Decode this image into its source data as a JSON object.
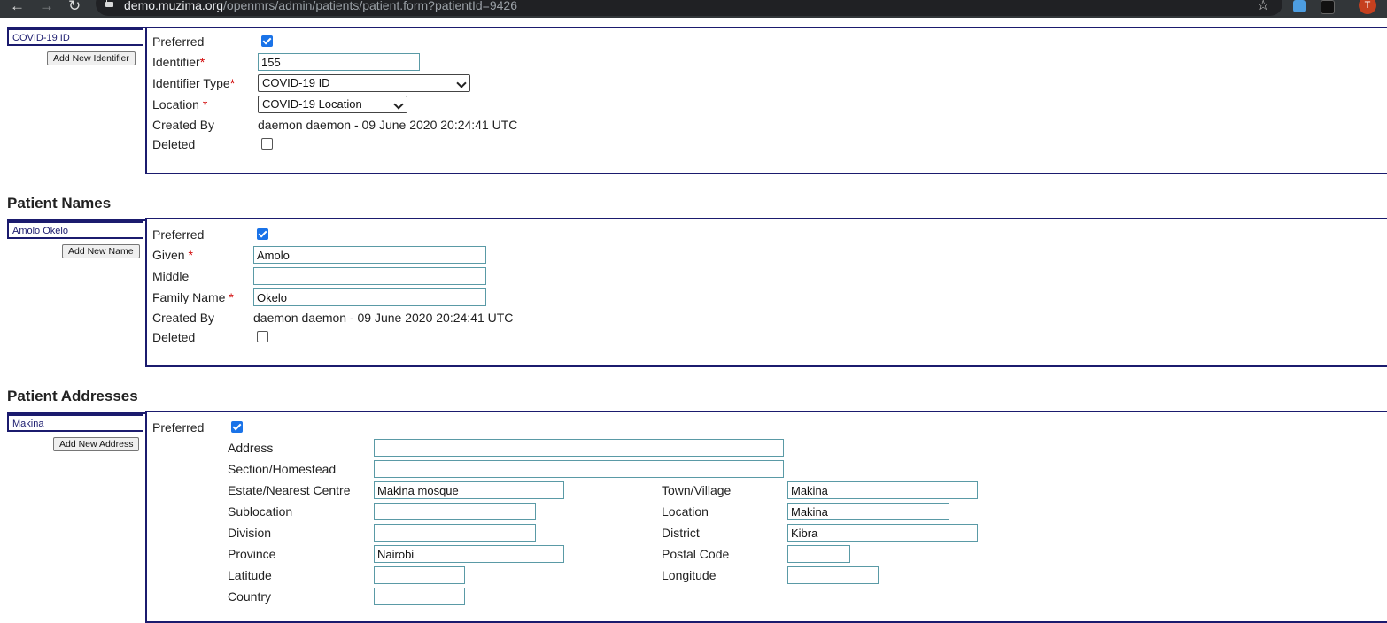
{
  "browser": {
    "url_host": "demo.muzima.org",
    "url_path": "/openmrs/admin/patients/patient.form?patientId=9426",
    "nav": {
      "back": "←",
      "forward": "→",
      "reload": "↻"
    },
    "star_icon": "☆",
    "avatar_letter": "T"
  },
  "identifier": {
    "tab_label": "COVID-19 ID",
    "add_button": "Add New Identifier",
    "preferred_label": "Preferred",
    "preferred_checked": true,
    "identifier_label": "Identifier",
    "identifier_value": "155",
    "type_label": "Identifier Type",
    "type_value": "COVID-19 ID",
    "location_label": "Location",
    "location_value": "COVID-19 Location",
    "created_by_label": "Created By",
    "created_by_value": "daemon daemon - 09 June 2020 20:24:41 UTC",
    "deleted_label": "Deleted",
    "deleted_checked": false
  },
  "names": {
    "section_title": "Patient Names",
    "tab_label": "Amolo Okelo",
    "add_button": "Add New Name",
    "preferred_label": "Preferred",
    "preferred_checked": true,
    "given_label": "Given",
    "given_value": "Amolo",
    "middle_label": "Middle",
    "middle_value": "",
    "family_label": "Family Name",
    "family_value": "Okelo",
    "created_by_label": "Created By",
    "created_by_value": "daemon daemon - 09 June 2020 20:24:41 UTC",
    "deleted_label": "Deleted",
    "deleted_checked": false
  },
  "addresses": {
    "section_title": "Patient Addresses",
    "tab_label": "Makina",
    "add_button": "Add New Address",
    "preferred_label": "Preferred",
    "preferred_checked": true,
    "fields": {
      "address": {
        "label": "Address",
        "value": ""
      },
      "section": {
        "label": "Section/Homestead",
        "value": ""
      },
      "estate": {
        "label": "Estate/Nearest Centre",
        "value": "Makina mosque"
      },
      "town": {
        "label": "Town/Village",
        "value": "Makina"
      },
      "sublocation": {
        "label": "Sublocation",
        "value": ""
      },
      "location": {
        "label": "Location",
        "value": "Makina"
      },
      "division": {
        "label": "Division",
        "value": ""
      },
      "district": {
        "label": "District",
        "value": "Kibra"
      },
      "province": {
        "label": "Province",
        "value": "Nairobi"
      },
      "postal": {
        "label": "Postal Code",
        "value": ""
      },
      "latitude": {
        "label": "Latitude",
        "value": ""
      },
      "longitude": {
        "label": "Longitude",
        "value": ""
      },
      "country": {
        "label": "Country",
        "value": ""
      }
    }
  },
  "required_marker": "*",
  "colors": {
    "border_navy": "#1b1b6e",
    "required_red": "#d00000",
    "checkbox_blue": "#1a73e8",
    "input_border": "#5a9aa6"
  }
}
